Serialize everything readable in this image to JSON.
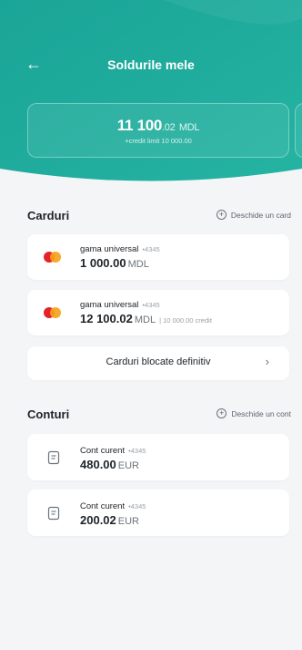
{
  "header": {
    "title": "Soldurile mele",
    "back_icon": "arrow-left-icon",
    "bg_color": "#1fa99a",
    "balance": {
      "integer": "11 100",
      "fraction": ".02",
      "currency": "MDL",
      "credit_note": "+credit limit 10 000.00"
    }
  },
  "cards_section": {
    "title": "Carduri",
    "open_link": "Deschide un card",
    "items": [
      {
        "name": "gama universal",
        "mask": "•4345",
        "amount": "1 000.00",
        "currency": "MDL",
        "extra": ""
      },
      {
        "name": "gama universal",
        "mask": "•4345",
        "amount": "12 100.02",
        "currency": "MDL",
        "extra": "| 10 000.00 credit"
      }
    ],
    "blocked_label": "Carduri blocate definitiv"
  },
  "accounts_section": {
    "title": "Conturi",
    "open_link": "Deschide un cont",
    "items": [
      {
        "name": "Cont curent",
        "mask": "•4345",
        "amount": "480.00",
        "currency": "EUR"
      },
      {
        "name": "Cont curent",
        "mask": "•4345",
        "amount": "200.02",
        "currency": "EUR"
      }
    ]
  }
}
